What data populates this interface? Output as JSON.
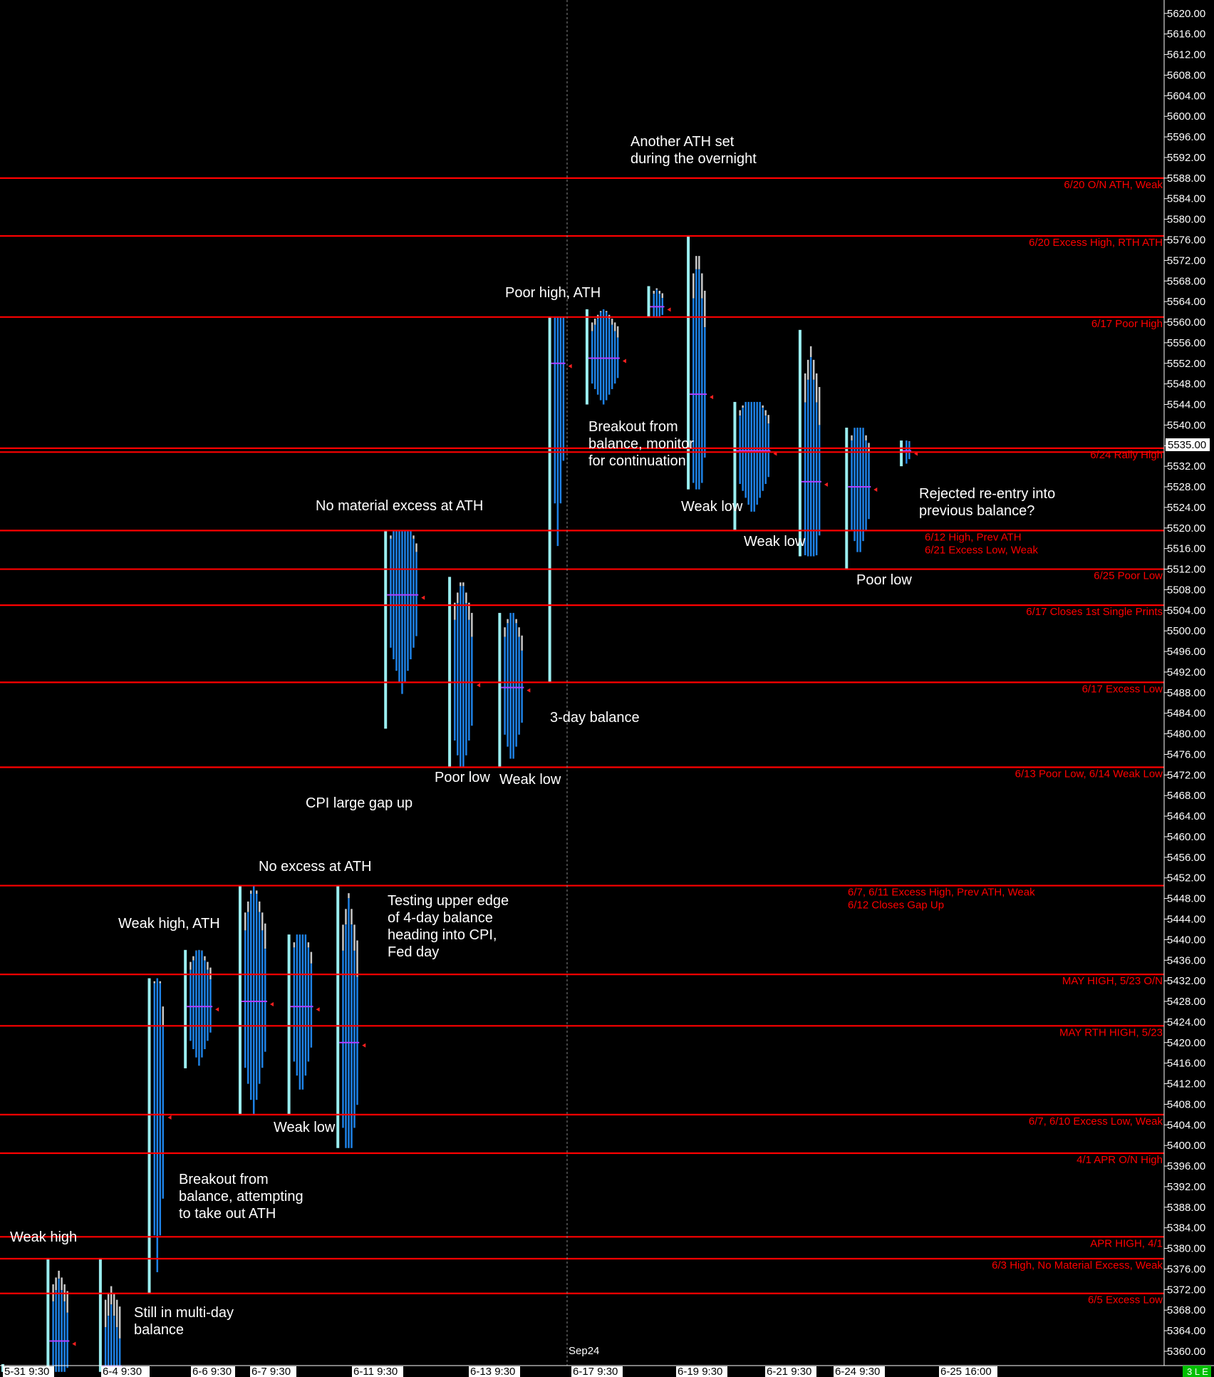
{
  "chart_data": {
    "type": "market-profile",
    "instrument_label": "Sep24",
    "current_price": "5535.00",
    "status_badge": "3 L E",
    "y_range": [
      5356,
      5622
    ],
    "y_tick_step": 4,
    "y_tick_labels": [
      "5620.00",
      "5616.00",
      "5612.00",
      "5608.00",
      "5604.00",
      "5600.00",
      "5596.00",
      "5592.00",
      "5588.00",
      "5584.00",
      "5580.00",
      "5576.00",
      "5572.00",
      "5568.00",
      "5564.00",
      "5560.00",
      "5556.00",
      "5552.00",
      "5548.00",
      "5544.00",
      "5540.00",
      "5536.00",
      "5532.00",
      "5528.00",
      "5524.00",
      "5520.00",
      "5516.00",
      "5512.00",
      "5508.00",
      "5504.00",
      "5500.00",
      "5496.00",
      "5492.00",
      "5488.00",
      "5484.00",
      "5480.00",
      "5476.00",
      "5472.00",
      "5468.00",
      "5464.00",
      "5460.00",
      "5456.00",
      "5452.00",
      "5448.00",
      "5444.00",
      "5440.00",
      "5436.00",
      "5432.00",
      "5428.00",
      "5424.00",
      "5420.00",
      "5416.00",
      "5412.00",
      "5408.00",
      "5404.00",
      "5400.00",
      "5396.00",
      "5392.00",
      "5388.00",
      "5384.00",
      "5380.00",
      "5376.00",
      "5372.00",
      "5368.00",
      "5364.00",
      "5360.00"
    ],
    "x_labels": [
      "5-31  9:30",
      "6-4  9:30",
      "6-6  9:30",
      "6-7  9:30",
      "6-11  9:30",
      "6-13  9:30",
      "6-17  9:30",
      "6-19  9:30",
      "6-21  9:30",
      "6-24  9:30",
      "6-25  16:00"
    ],
    "levels": [
      {
        "price": 5588.0,
        "label": "6/20 O/N ATH, Weak"
      },
      {
        "price": 5576.75,
        "label": "6/20 Excess High, RTH ATH"
      },
      {
        "price": 5561.0,
        "label": "6/17 Poor High"
      },
      {
        "price": 5535.5,
        "label": "6/24 Rally High"
      },
      {
        "price": 5534.75,
        "label": ""
      },
      {
        "price": 5519.5,
        "label": "6/12 High, Prev ATH\n6/21 Excess Low, Weak"
      },
      {
        "price": 5512.0,
        "label": "6/25 Poor Low"
      },
      {
        "price": 5505.0,
        "label": "6/17 Closes 1st Single Prints"
      },
      {
        "price": 5490.0,
        "label": "6/17 Excess Low"
      },
      {
        "price": 5473.5,
        "label": "6/13 Poor Low, 6/14 Weak Low"
      },
      {
        "price": 5450.5,
        "label": "6/7, 6/11 Excess High, Prev ATH, Weak\n6/12 Closes Gap Up"
      },
      {
        "price": 5433.25,
        "label": "MAY HIGH, 5/23 O/N"
      },
      {
        "price": 5423.25,
        "label": "MAY RTH HIGH, 5/23"
      },
      {
        "price": 5406.0,
        "label": "6/7, 6/10 Excess Low, Weak"
      },
      {
        "price": 5398.5,
        "label": "4/1 APR O/N High"
      },
      {
        "price": 5382.25,
        "label": "APR HIGH, 4/1"
      },
      {
        "price": 5378.0,
        "label": "6/3 High, No Material Excess, Weak"
      },
      {
        "price": 5371.25,
        "label": "6/5 Excess Low"
      }
    ],
    "profiles": [
      {
        "session": "5-31",
        "high": 5357.5,
        "low": 5356,
        "poc": 5356,
        "pos": 0.0,
        "bars": 2
      },
      {
        "session": "6-3",
        "high": 5378.0,
        "low": 5356,
        "poc": 5362,
        "pos": 0.04,
        "bars": 6
      },
      {
        "session": "6-4",
        "high": 5378.0,
        "low": 5356,
        "poc": 5357,
        "pos": 0.085,
        "bars": 6
      },
      {
        "session": "6-5",
        "high": 5432.5,
        "low": 5371.25,
        "poc": 5406,
        "pos": 0.127,
        "bars": 4
      },
      {
        "session": "6-6",
        "high": 5438.0,
        "low": 5415.0,
        "poc": 5427,
        "pos": 0.158,
        "bars": 8
      },
      {
        "session": "6-7",
        "high": 5450.5,
        "low": 5406.0,
        "poc": 5428,
        "pos": 0.205,
        "bars": 8
      },
      {
        "session": "6-10",
        "high": 5441.0,
        "low": 5406.0,
        "poc": 5427,
        "pos": 0.247,
        "bars": 7
      },
      {
        "session": "6-11",
        "high": 5450.5,
        "low": 5399.5,
        "poc": 5420,
        "pos": 0.289,
        "bars": 6
      },
      {
        "session": "6-12",
        "high": 5519.5,
        "low": 5481.0,
        "poc": 5507,
        "pos": 0.33,
        "bars": 10
      },
      {
        "session": "6-13",
        "high": 5510.5,
        "low": 5473.5,
        "poc": 5490,
        "pos": 0.385,
        "bars": 7
      },
      {
        "session": "6-14",
        "high": 5503.5,
        "low": 5473.5,
        "poc": 5489,
        "pos": 0.428,
        "bars": 7
      },
      {
        "session": "6-17",
        "high": 5561.0,
        "low": 5490.0,
        "poc": 5552,
        "pos": 0.471,
        "bars": 4
      },
      {
        "session": "6-18",
        "high": 5562.5,
        "low": 5544.0,
        "poc": 5553,
        "pos": 0.503,
        "bars": 10
      },
      {
        "session": "6-19",
        "high": 5567.0,
        "low": 5561.0,
        "poc": 5563,
        "pos": 0.556,
        "bars": 4
      },
      {
        "session": "6-20",
        "high": 5576.75,
        "low": 5527.5,
        "poc": 5546,
        "pos": 0.59,
        "bars": 5
      },
      {
        "session": "6-21",
        "high": 5544.5,
        "low": 5519.5,
        "poc": 5535,
        "pos": 0.63,
        "bars": 11
      },
      {
        "session": "6-24",
        "high": 5558.5,
        "low": 5514.5,
        "poc": 5529,
        "pos": 0.686,
        "bars": 6
      },
      {
        "session": "6-25",
        "high": 5539.5,
        "low": 5512.0,
        "poc": 5528,
        "pos": 0.726,
        "bars": 7
      },
      {
        "session": "6-26",
        "high": 5537.0,
        "low": 5532.0,
        "poc": 5535,
        "pos": 0.773,
        "bars": 2
      }
    ]
  },
  "annotations": [
    {
      "text": "Another ATH set\nduring the overnight"
    },
    {
      "text": "Poor high,  ATH"
    },
    {
      "text": "Breakout from\nbalance, monitor\nfor continuation"
    },
    {
      "text": "No material excess at ATH"
    },
    {
      "text": "Weak low"
    },
    {
      "text": "Weak low"
    },
    {
      "text": "Rejected re-entry into\nprevious balance?"
    },
    {
      "text": "Poor low"
    },
    {
      "text": "3-day balance"
    },
    {
      "text": "Poor low"
    },
    {
      "text": "Weak low"
    },
    {
      "text": "CPI large gap up"
    },
    {
      "text": "No excess at ATH"
    },
    {
      "text": "Weak high, ATH"
    },
    {
      "text": "Testing upper edge\nof 4-day balance\nheading into CPI,\nFed day"
    },
    {
      "text": "Weak low"
    },
    {
      "text": "Breakout from\nbalance, attempting\nto take out ATH"
    },
    {
      "text": "Weak high"
    },
    {
      "text": "Still in multi-day\nbalance"
    }
  ],
  "colors": {
    "background": "#000000",
    "level_line": "#ff0000",
    "profile_blue": "#1e82e6",
    "profile_white": "#c8c8c8",
    "profile_cyan": "#9aeef0",
    "poc": "#b040ff",
    "axis_label_bg": "#ffffff",
    "status_green": "#00c000"
  }
}
